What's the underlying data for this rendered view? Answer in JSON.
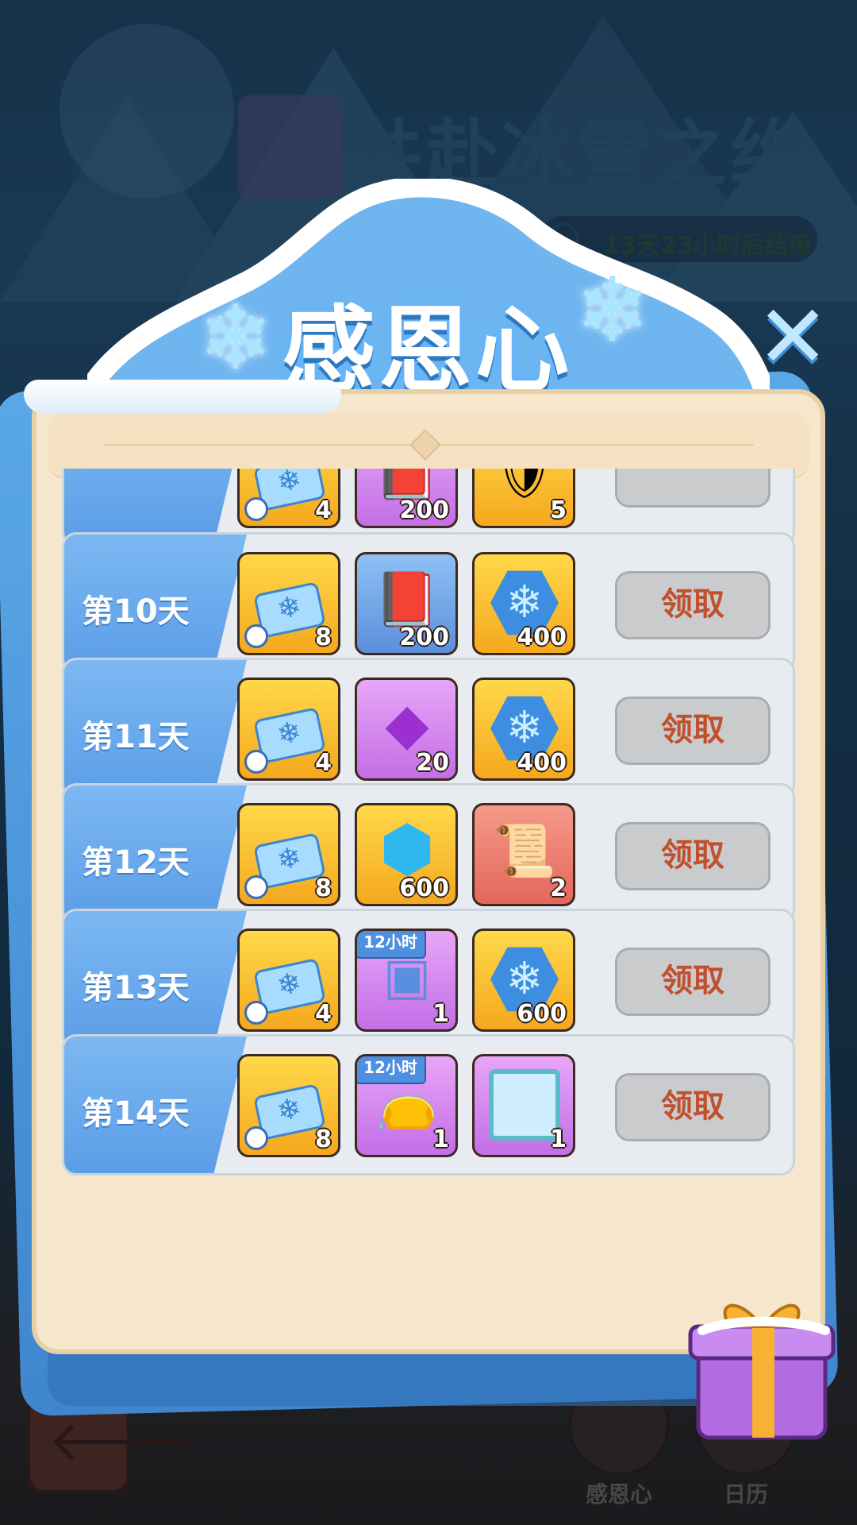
{
  "background": {
    "event_title": "共赴冰雪之约",
    "timer": "13天23小时后结束"
  },
  "popup": {
    "title": "感恩心",
    "close_icon": "close-icon"
  },
  "rows": [
    {
      "day": "",
      "items": [
        {
          "style": "gold",
          "icon": "ticket",
          "qty": "4",
          "timer": true
        },
        {
          "style": "purple",
          "icon": "book",
          "qty": "200"
        },
        {
          "style": "gold",
          "icon": "shield",
          "qty": "5"
        }
      ],
      "claim": ""
    },
    {
      "day": "第10天",
      "items": [
        {
          "style": "gold",
          "icon": "ticket",
          "qty": "8",
          "timer": true
        },
        {
          "style": "blue",
          "icon": "book",
          "qty": "200"
        },
        {
          "style": "gold",
          "icon": "snow-badge",
          "qty": "400"
        }
      ],
      "claim": "领取"
    },
    {
      "day": "第11天",
      "items": [
        {
          "style": "gold",
          "icon": "ticket",
          "qty": "4",
          "timer": true
        },
        {
          "style": "purple",
          "icon": "crystal",
          "qty": "20"
        },
        {
          "style": "gold",
          "icon": "snow-badge",
          "qty": "400"
        }
      ],
      "claim": "领取"
    },
    {
      "day": "第12天",
      "items": [
        {
          "style": "gold",
          "icon": "ticket",
          "qty": "8",
          "timer": true
        },
        {
          "style": "gold",
          "icon": "diamond",
          "qty": "600"
        },
        {
          "style": "red",
          "icon": "scroll",
          "qty": "2"
        }
      ],
      "claim": "领取"
    },
    {
      "day": "第13天",
      "items": [
        {
          "style": "gold",
          "icon": "ticket",
          "qty": "4",
          "timer": true
        },
        {
          "style": "purple",
          "icon": "ice-blocks",
          "qty": "1",
          "tag": "12小时"
        },
        {
          "style": "gold",
          "icon": "snow-badge",
          "qty": "600"
        }
      ],
      "claim": "领取"
    },
    {
      "day": "第14天",
      "items": [
        {
          "style": "gold",
          "icon": "ticket",
          "qty": "8",
          "timer": true
        },
        {
          "style": "purple",
          "icon": "gem-bag",
          "qty": "1",
          "tag": "12小时"
        },
        {
          "style": "purple",
          "icon": "frame",
          "qty": "1"
        }
      ],
      "claim": "领取"
    }
  ],
  "bottom_nav": {
    "items": [
      {
        "label": "感恩心"
      },
      {
        "label": "日历"
      }
    ]
  }
}
